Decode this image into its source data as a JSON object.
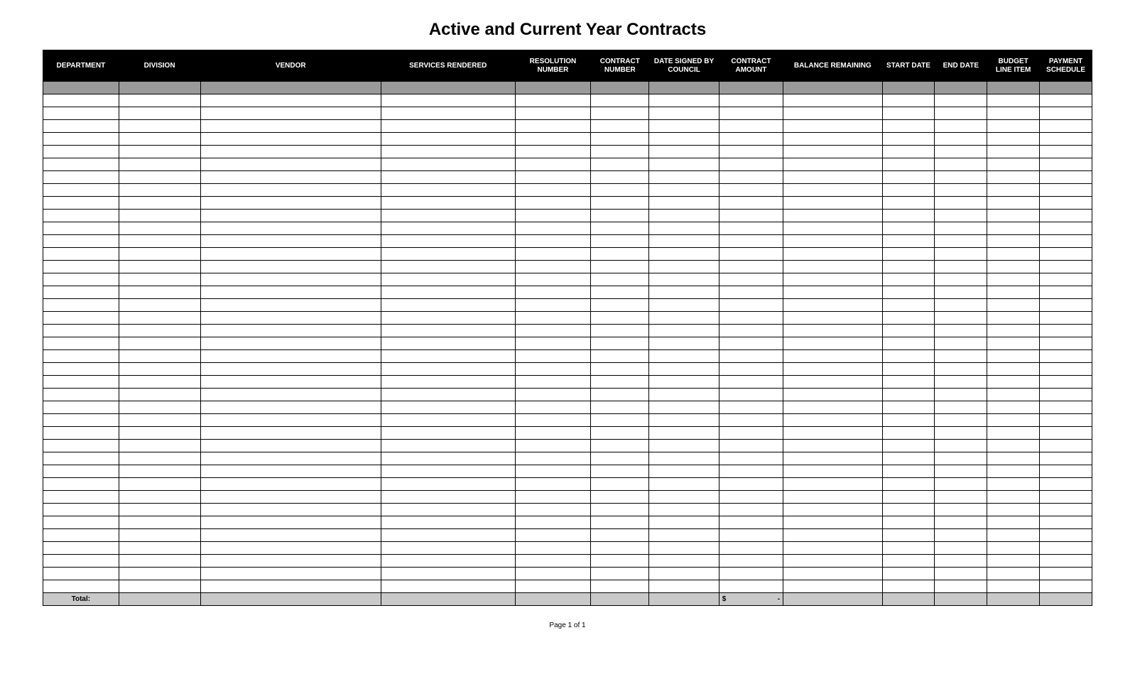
{
  "title": "Active and Current Year Contracts",
  "columns": [
    "DEPARTMENT",
    "DIVISION",
    "VENDOR",
    "SERVICES RENDERED",
    "RESOLUTION NUMBER",
    "CONTRACT NUMBER",
    "DATE SIGNED BY COUNCIL",
    "CONTRACT AMOUNT",
    "BALANCE REMAINING",
    "START DATE",
    "END DATE",
    "BUDGET LINE ITEM",
    "PAYMENT SCHEDULE"
  ],
  "shaded_row_indices": [
    0
  ],
  "blank_row_count": 40,
  "total": {
    "label": "Total:",
    "amount_prefix": "$",
    "amount_value": "-"
  },
  "footer": "Page 1 of 1"
}
